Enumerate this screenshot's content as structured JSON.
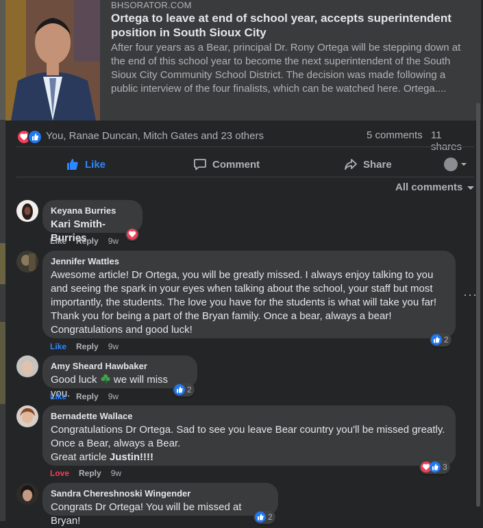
{
  "preview": {
    "domain": "BHSORATOR.COM",
    "title": "Ortega to leave at end of school year, accepts superintendent position in South Sioux City",
    "description": "After four years as a Bear, principal Dr. Rony Ortega will be stepping down at the end of this school year to become the next superintendent of the South Sioux City Community School District. The decision was made following a public interview of the four finalists, which can be watched here. Ortega...."
  },
  "summary": {
    "reactors": "You, Ranae Duncan, Mitch Gates and 23 others",
    "comments": "5 comments",
    "shares": "11 shares"
  },
  "actions": {
    "like": "Like",
    "comment": "Comment",
    "share": "Share"
  },
  "filter": "All comments",
  "colors": {
    "background": "#242526",
    "bubble": "#3a3b3c",
    "like_blue": "#2d88ff",
    "love_red": "#f33e58"
  },
  "comments": [
    {
      "author": "Keyana Burries",
      "text": "Kari Smith-Burries",
      "like": "Like",
      "reply": "Reply",
      "time": "9w"
    },
    {
      "author": "Jennifer Wattles",
      "text": "Awesome article! Dr Ortega, you will be greatly missed. I always enjoy talking to you and seeing the spark in your eyes when talking about the school, your staff but most importantly, the students. The love you have for the students is what will take you far! Thank you for being a part of the Bryan family. Once a bear, always a bear! Congratulations and good luck!",
      "like": "Like",
      "reply": "Reply",
      "time": "9w",
      "reactions": "2"
    },
    {
      "author": "Amy Sheard Hawbaker",
      "text_before": "Good luck",
      "text_after": "we will miss you.",
      "like": "Like",
      "reply": "Reply",
      "time": "9w",
      "reactions": "2"
    },
    {
      "author": "Bernadette Wallace",
      "line1": "Congratulations Dr Ortega. Sad to see you leave Bear country you'll be missed greatly.",
      "line2": "Once a Bear, always a Bear.",
      "line3_before": "Great article",
      "line3_tag": "Justin!!!!",
      "like": "Love",
      "reply": "Reply",
      "time": "9w",
      "reactions": "3"
    },
    {
      "author": "Sandra Chereshnoski Wingender",
      "text": "Congrats Dr Ortega! You will be missed at Bryan!",
      "reactions": "2"
    }
  ]
}
